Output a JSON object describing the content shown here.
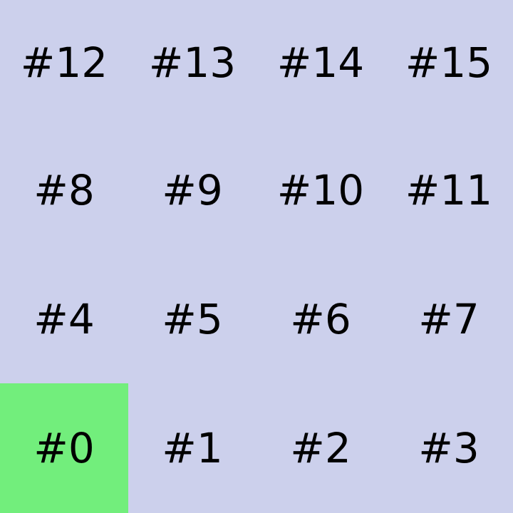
{
  "board": {
    "background_color": "#ccd0ec",
    "highlight_color": "#72ee7c",
    "highlighted_cell": "#0",
    "rows": [
      [
        "#12",
        "#13",
        "#14",
        "#15"
      ],
      [
        "#8",
        "#9",
        "#10",
        "#11"
      ],
      [
        "#4",
        "#5",
        "#6",
        "#7"
      ],
      [
        "#0",
        "#1",
        "#2",
        "#3"
      ]
    ]
  }
}
